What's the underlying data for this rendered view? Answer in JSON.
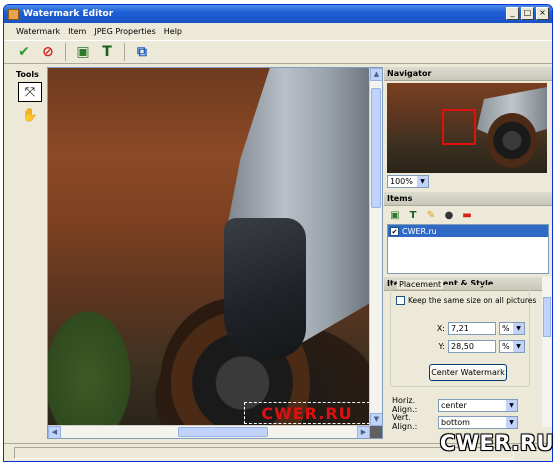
{
  "window": {
    "title": "Watermark Editor"
  },
  "window_buttons": {
    "minimize": "_",
    "maximize": "□",
    "close": "×"
  },
  "menu": [
    "Watermark",
    "Item",
    "JPEG Properties",
    "Help"
  ],
  "toolbar_icons": [
    "check-icon",
    "cancel-icon",
    "add-image-icon",
    "add-text-icon",
    "export-icon"
  ],
  "tools": {
    "label": "Tools",
    "items": [
      {
        "name": "move-tool-icon",
        "glyph": "⤧"
      },
      {
        "name": "hand-tool-icon",
        "glyph": "✋"
      }
    ]
  },
  "canvas": {
    "watermark_text": "CWER.RU"
  },
  "navigator": {
    "title": "Navigator",
    "zoom": "100%"
  },
  "items": {
    "title": "Items",
    "list": [
      {
        "label": "CWER.ru",
        "checked": true,
        "selected": true
      }
    ]
  },
  "placement": {
    "title": "Item Placement & Style",
    "group_label": "Placement",
    "same_size_label": "Keep the same size on all pictures",
    "x_label": "X:",
    "x_value": "7,21",
    "x_unit": "%",
    "y_label": "Y:",
    "y_value": "28,50",
    "y_unit": "%",
    "center_button": "Center Watermark",
    "horiz_label": "Horiz. Align.:",
    "horiz_value": "center",
    "vert_label": "Vert. Align.:",
    "vert_value": "bottom"
  },
  "overlay_logo": "CWER.RU",
  "colors": {
    "accent": "#316ac5",
    "titlebar": "#1e5fd6",
    "watermark": "#e01010"
  }
}
